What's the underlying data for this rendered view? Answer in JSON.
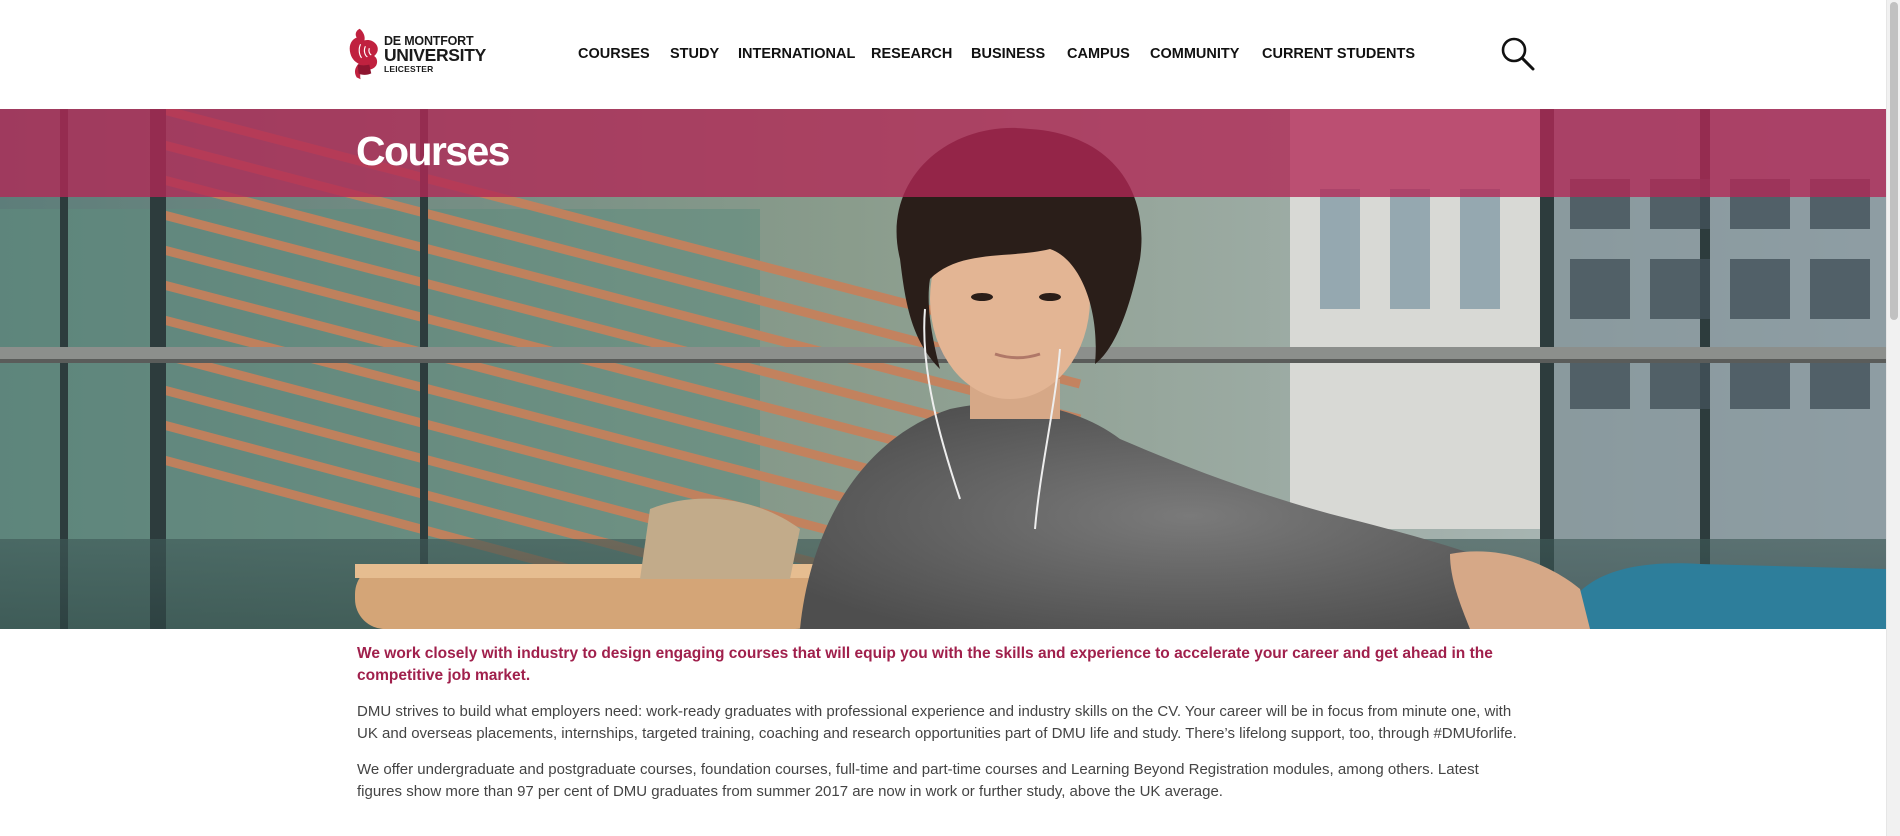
{
  "header": {
    "logo": {
      "line1": "DE MONTFORT",
      "line2": "UNIVERSITY",
      "line3": "LEICESTER"
    },
    "nav": [
      {
        "label": "COURSES"
      },
      {
        "label": "STUDY"
      },
      {
        "label": "INTERNATIONAL"
      },
      {
        "label": "RESEARCH"
      },
      {
        "label": "BUSINESS"
      },
      {
        "label": "CAMPUS"
      },
      {
        "label": "COMMUNITY"
      },
      {
        "label": "CURRENT STUDENTS"
      }
    ],
    "search_icon": "search-icon"
  },
  "hero": {
    "title": "Courses",
    "band_color": "#b22856"
  },
  "content": {
    "lead": "We work closely with industry to design engaging courses that will equip you with the skills and experience to accelerate your career and get ahead in the competitive job market.",
    "paragraphs": [
      "DMU strives to build what employers need: work-ready graduates with professional experience and industry skills on the CV. Your career will be in focus from minute one, with UK and overseas placements, internships, targeted training, coaching and research opportunities part of DMU life and study. There’s lifelong support, too, through #DMUforlife.",
      "We offer undergraduate and postgraduate courses, foundation courses, full-time and part-time courses and Learning Beyond Registration modules, among others. Latest figures show more than 97 per cent of DMU graduates from summer 2017 are now in work or further study, above the UK average."
    ]
  },
  "colors": {
    "accent": "#a0204c",
    "text": "#444444",
    "nav_text": "#111111"
  }
}
